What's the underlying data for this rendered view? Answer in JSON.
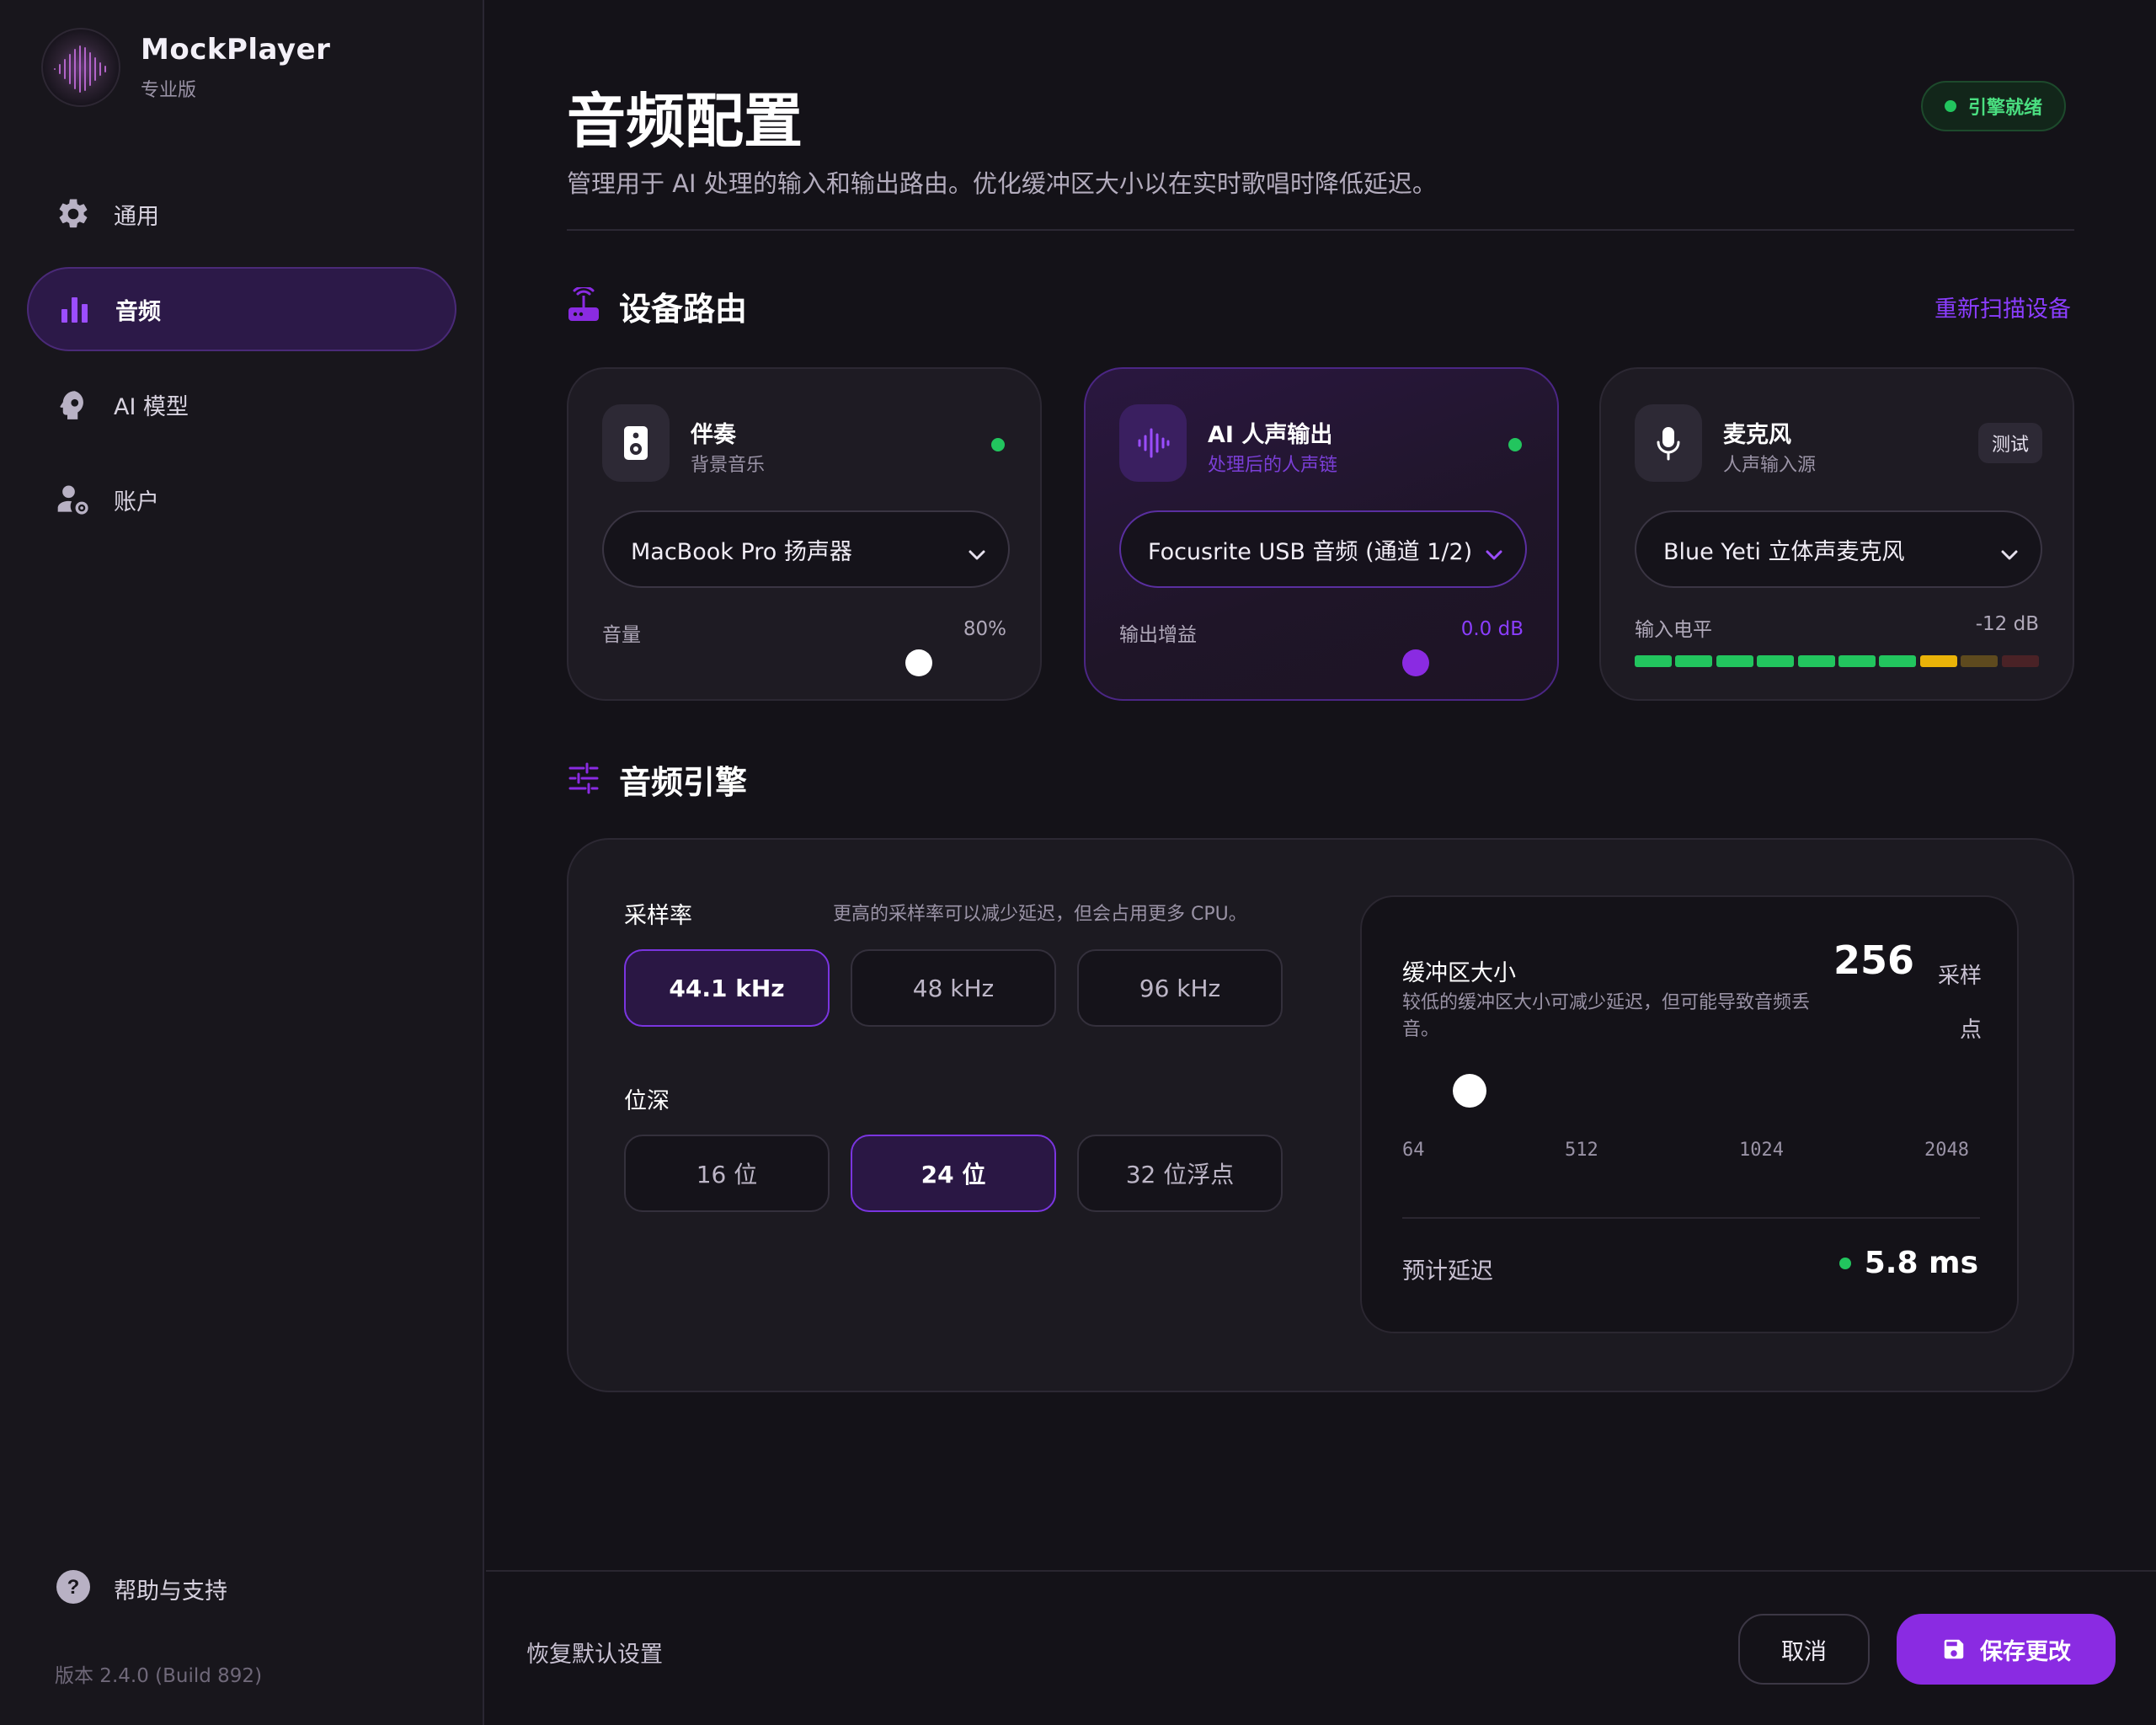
{
  "brand": {
    "name": "MockPlayer",
    "edition": "专业版"
  },
  "sidebar": {
    "items": [
      {
        "label": "通用",
        "icon": "gear-icon"
      },
      {
        "label": "音频",
        "icon": "bar-chart-icon",
        "active": true
      },
      {
        "label": "AI 模型",
        "icon": "ai-head-icon"
      },
      {
        "label": "账户",
        "icon": "user-settings-icon"
      }
    ],
    "help_label": "帮助与支持",
    "version": "版本 2.4.0 (Build 892)"
  },
  "header": {
    "title": "音频配置",
    "description": "管理用于 AI 处理的输入和输出路由。优化缓冲区大小以在实时歌唱时降低延迟。",
    "status": "引擎就绪"
  },
  "routing": {
    "title": "设备路由",
    "rescan_label": "重新扫描设备",
    "cards": [
      {
        "title": "伴奏",
        "subtitle": "背景音乐",
        "device": "MacBook Pro 扬声器",
        "meta_label": "音量",
        "meta_value": "80%",
        "level": 0.8,
        "online": true
      },
      {
        "title": "AI 人声输出",
        "subtitle": "处理后的人声链",
        "device": "Focusrite USB 音频 (通道 1/2)",
        "meta_label": "输出增益",
        "meta_value": "0.0 dB",
        "online": true
      },
      {
        "title": "麦克风",
        "subtitle": "人声输入源",
        "device": "Blue Yeti 立体声麦克风",
        "meta_label": "输入电平",
        "meta_value": "-12 dB",
        "test_label": "测试"
      }
    ]
  },
  "engine": {
    "title": "音频引擎",
    "sample_rate": {
      "label": "采样率",
      "hint": "更高的采样率可以减少延迟，但会占用更多 CPU。",
      "options": [
        "44.1 kHz",
        "48 kHz",
        "96 kHz"
      ],
      "selected": "44.1 kHz"
    },
    "bit_depth": {
      "label": "位深",
      "options": [
        "16 位",
        "24 位",
        "32 位浮点"
      ],
      "selected": "24 位"
    },
    "buffer": {
      "label": "缓冲区大小",
      "description": "较低的缓冲区大小可减少延迟，但可能导致音频丢音。",
      "value": "256",
      "unit": "采样点",
      "ticks": [
        "64",
        "512",
        "1024",
        "2048"
      ],
      "latency_label": "预计延迟",
      "latency_value": "5.8 ms"
    }
  },
  "footer": {
    "reset": "恢复默认设置",
    "cancel": "取消",
    "save": "保存更改"
  },
  "colors": {
    "accent": "#8a2be2",
    "success": "#22c55e",
    "warning": "#eab308",
    "background": "#141218"
  }
}
